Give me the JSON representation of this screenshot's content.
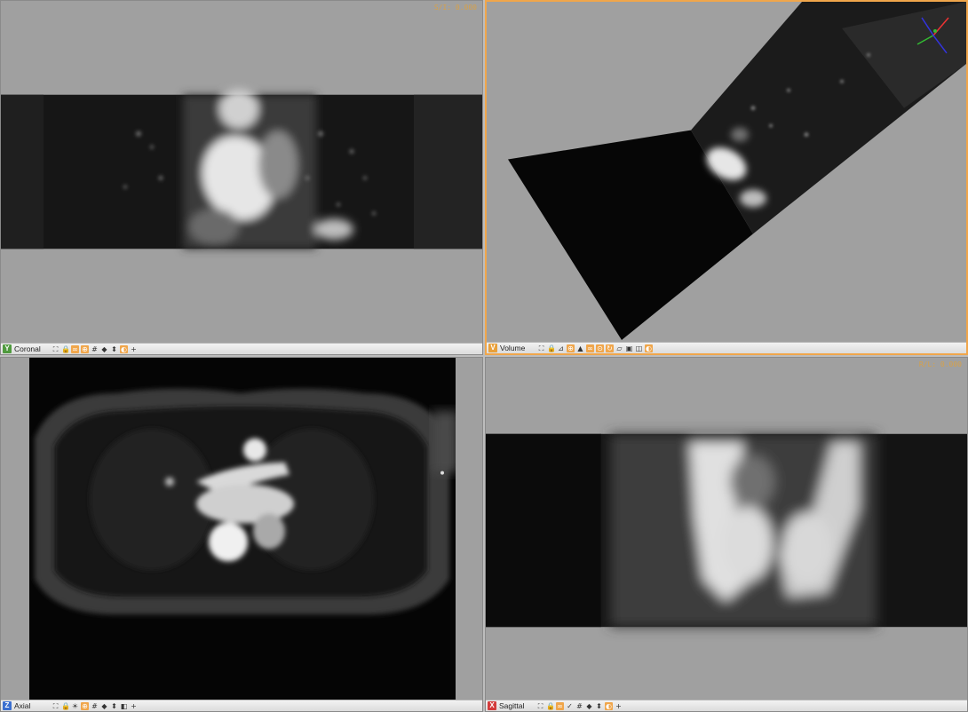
{
  "views": {
    "coronal": {
      "label": "Coronal",
      "badge": "Y",
      "badge_color": "#4f9a3e",
      "overlay": "S/I: 0.000"
    },
    "volume": {
      "label": "Volume",
      "badge": "V",
      "badge_color": "#e9a03a"
    },
    "axial": {
      "label": "Axial",
      "badge": "Z",
      "badge_color": "#3b6fd0"
    },
    "sagittal": {
      "label": "Sagittal",
      "badge": "X",
      "badge_color": "#d33c3c",
      "overlay": "R/L: 0.000"
    }
  },
  "colors": {
    "active_border": "#f0a64b",
    "background": "#a0a0a0"
  },
  "toolbar_icons": {
    "coronal": [
      "fit-icon",
      "lock-icon",
      "link-icon",
      "pin-icon",
      "grid-icon",
      "flip-horizontal-icon",
      "flip-vertical-icon",
      "settings-icon",
      "crosshair-icon"
    ],
    "volume": [
      "fit-icon",
      "lock-icon",
      "ruler-icon",
      "pin-icon",
      "cone-icon",
      "link-icon",
      "center-icon",
      "orientation-icon",
      "layers-icon",
      "cube-icon",
      "camera-icon",
      "settings-icon"
    ],
    "axial": [
      "fit-icon",
      "lock-icon",
      "sun-icon",
      "pin-icon",
      "grid-icon",
      "flip-horizontal-icon",
      "flip-vertical-icon",
      "layout-icon",
      "crosshair-icon"
    ],
    "sagittal": [
      "fit-icon",
      "lock-icon",
      "link-icon",
      "pin-icon",
      "grid-icon",
      "flip-horizontal-icon",
      "flip-vertical-icon",
      "settings-icon",
      "crosshair-icon"
    ]
  }
}
